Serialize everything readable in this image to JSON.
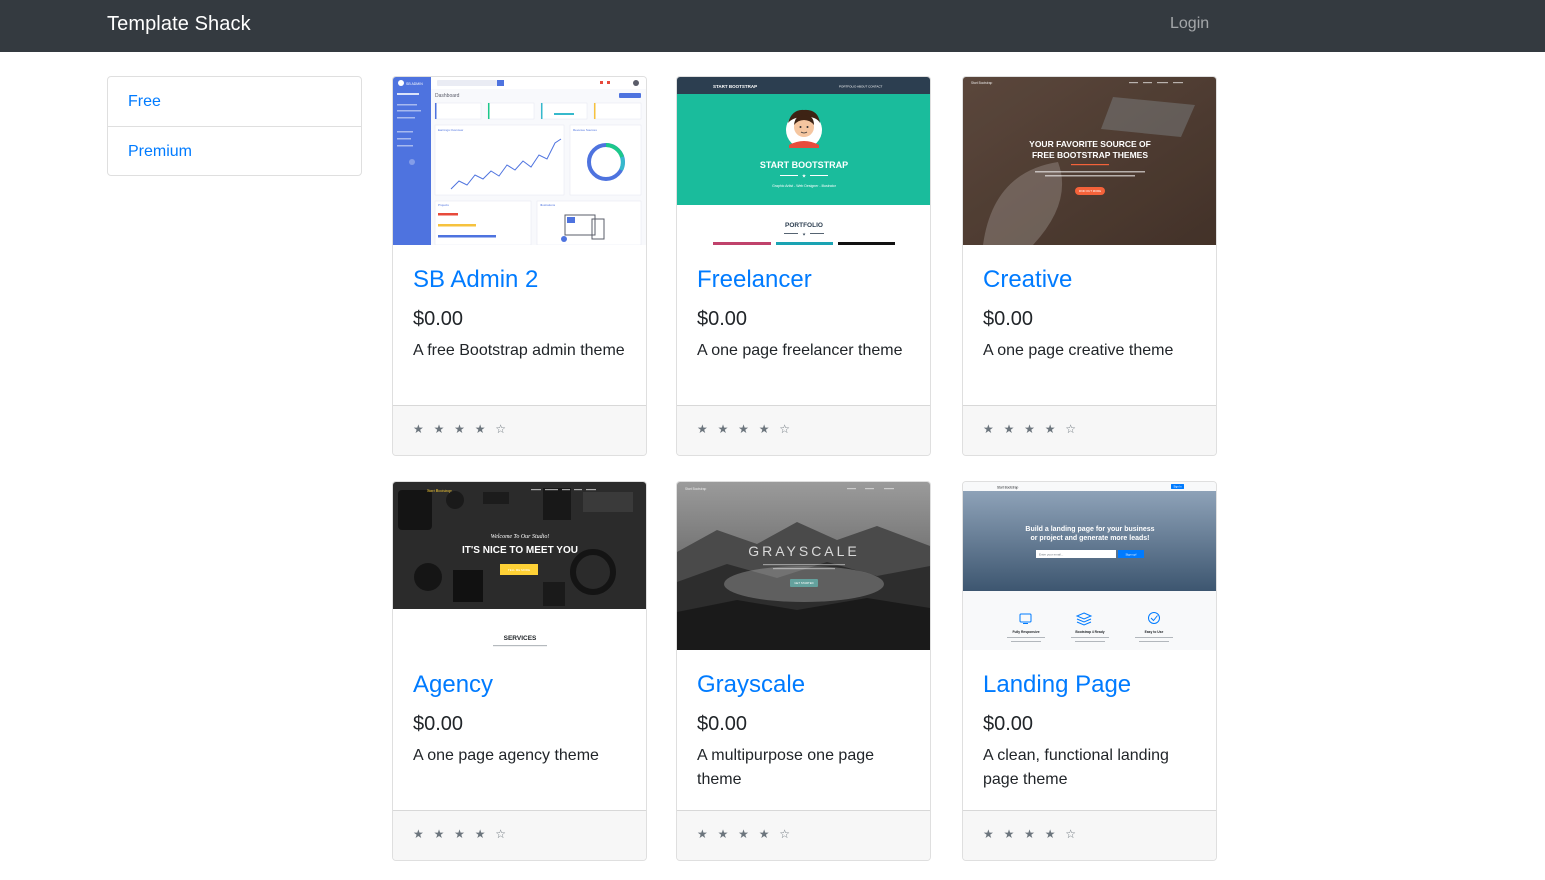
{
  "navbar": {
    "brand": "Template Shack",
    "login": "Login"
  },
  "sidebar": {
    "items": [
      {
        "label": "Free"
      },
      {
        "label": "Premium"
      }
    ]
  },
  "cards": [
    {
      "title": "SB Admin 2",
      "price": "$0.00",
      "description": "A free Bootstrap admin theme",
      "rating": "★ ★ ★ ★ ☆",
      "thumbnail_icon": "sb-admin-dashboard-preview"
    },
    {
      "title": "Freelancer",
      "price": "$0.00",
      "description": "A one page freelancer theme",
      "rating": "★ ★ ★ ★ ☆",
      "thumbnail_icon": "freelancer-preview"
    },
    {
      "title": "Creative",
      "price": "$0.00",
      "description": "A one page creative theme",
      "rating": "★ ★ ★ ★ ☆",
      "thumbnail_icon": "creative-preview"
    },
    {
      "title": "Agency",
      "price": "$0.00",
      "description": "A one page agency theme",
      "rating": "★ ★ ★ ★ ☆",
      "thumbnail_icon": "agency-preview"
    },
    {
      "title": "Grayscale",
      "price": "$0.00",
      "description": "A multipurpose one page theme",
      "rating": "★ ★ ★ ★ ☆",
      "thumbnail_icon": "grayscale-preview"
    },
    {
      "title": "Landing Page",
      "price": "$0.00",
      "description": "A clean, functional landing page theme",
      "rating": "★ ★ ★ ★ ☆",
      "thumbnail_icon": "landing-page-preview"
    }
  ],
  "thumbnails": {
    "sb_admin": {
      "sidebar_logo": "SB ADMIN",
      "heading": "Dashboard",
      "chart_title": "Earnings Overview",
      "donut_title": "Revenue Sources",
      "projects_title": "Projects",
      "illustrations_title": "Illustrations"
    },
    "freelancer": {
      "nav_brand": "START BOOTSTRAP",
      "nav_links": "PORTFOLIO   ABOUT   CONTACT",
      "hero_title": "START BOOTSTRAP",
      "hero_sub": "Graphic Artist - Web Designer - Illustrator",
      "section_title": "PORTFOLIO"
    },
    "creative": {
      "nav_brand": "Start Bootstrap",
      "headline_1": "YOUR FAVORITE SOURCE OF",
      "headline_2": "FREE BOOTSTRAP THEMES",
      "button": "FIND OUT MORE"
    },
    "agency": {
      "nav_brand": "Start Bootstrap",
      "welcome": "Welcome To Our Studio!",
      "headline": "IT'S NICE TO MEET YOU",
      "button": "TELL ME MORE",
      "section": "SERVICES"
    },
    "grayscale": {
      "nav_brand": "Start Bootstrap",
      "title": "GRAYSCALE",
      "button": "GET STARTED"
    },
    "landing": {
      "nav_brand": "Start Bootstrap",
      "nav_button": "Sign In",
      "headline_1": "Build a landing page for your business",
      "headline_2": "or project and generate more leads!",
      "input_placeholder": "Enter your email...",
      "submit": "Sign up!",
      "feature_1": "Fully Responsive",
      "feature_2": "Bootstrap 4 Ready",
      "feature_3": "Easy to Use"
    }
  },
  "colors": {
    "navbar": "#343a40",
    "link": "#007bff",
    "freelancer_teal": "#1abc9c",
    "sb_admin_blue": "#4e73df",
    "agency_yellow": "#fed136",
    "creative_orange": "#f4623a"
  }
}
